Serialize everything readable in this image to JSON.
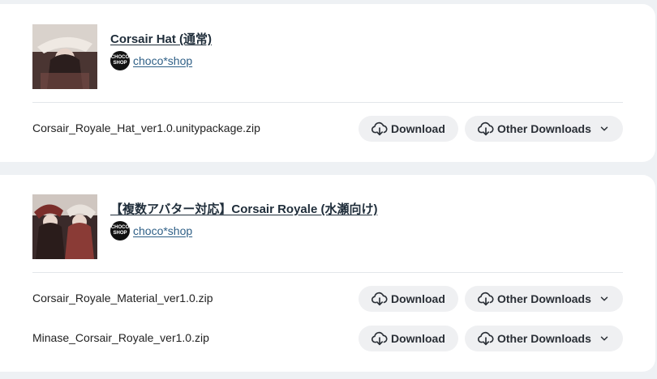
{
  "items": [
    {
      "title": "Corsair Hat (通常)",
      "shop": {
        "avatar_text": "CHOCO SHOP",
        "name": "choco*shop"
      },
      "files": [
        {
          "name": "Corsair_Royale_Hat_ver1.0.unitypackage.zip",
          "download_label": "Download",
          "other_label": "Other Downloads"
        }
      ]
    },
    {
      "title": "【複数アバター対応】Corsair Royale (水瀬向け)",
      "shop": {
        "avatar_text": "CHOCO SHOP",
        "name": "choco*shop"
      },
      "files": [
        {
          "name": "Corsair_Royale_Material_ver1.0.zip",
          "download_label": "Download",
          "other_label": "Other Downloads"
        },
        {
          "name": "Minase_Corsair_Royale_ver1.0.zip",
          "download_label": "Download",
          "other_label": "Other Downloads"
        }
      ]
    }
  ],
  "icons": {
    "download": "cloud-download-icon",
    "chevron": "chevron-down-icon"
  }
}
